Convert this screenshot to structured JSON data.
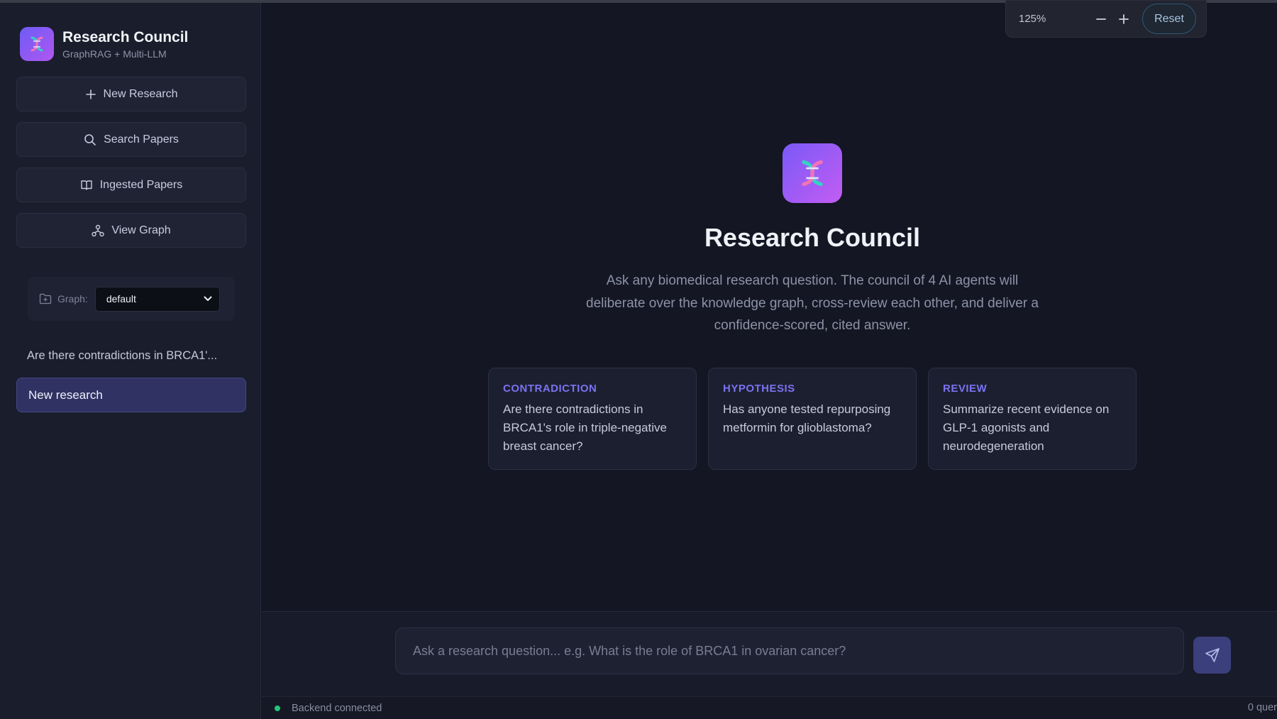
{
  "brand": {
    "title": "Research Council",
    "subtitle": "GraphRAG + Multi-LLM"
  },
  "sidebar": {
    "actions": [
      {
        "label": "New Research",
        "icon": "plus-icon"
      },
      {
        "label": "Search Papers",
        "icon": "search-icon"
      },
      {
        "label": "Ingested Papers",
        "icon": "book-icon"
      },
      {
        "label": "View Graph",
        "icon": "graph-icon"
      }
    ],
    "graph_label": "Graph:",
    "graph_value": "default",
    "history": [
      {
        "label": "Are there contradictions in BRCA1'...",
        "active": false
      },
      {
        "label": "New research",
        "active": true
      }
    ]
  },
  "hero": {
    "title": "Research Council",
    "description": "Ask any biomedical research question. The council of 4 AI agents will deliberate over the knowledge graph, cross-review each other, and deliver a confidence-scored, cited answer."
  },
  "cards": [
    {
      "tag": "CONTRADICTION",
      "text": "Are there contradictions in BRCA1's role in triple-negative breast cancer?"
    },
    {
      "tag": "HYPOTHESIS",
      "text": "Has anyone tested repurposing metformin for glioblastoma?"
    },
    {
      "tag": "REVIEW",
      "text": "Summarize recent evidence on GLP-1 agonists and neurodegeneration"
    }
  ],
  "composer": {
    "placeholder": "Ask a research question... e.g. What is the role of BRCA1 in ovarian cancer?"
  },
  "status": {
    "text": "Backend connected",
    "right": "0 quer",
    "color": "#22c57a"
  },
  "zoom": {
    "level": "125%",
    "reset_label": "Reset"
  },
  "colors": {
    "accent": "#6d5cf6",
    "card_tag": "#7a73f0"
  }
}
